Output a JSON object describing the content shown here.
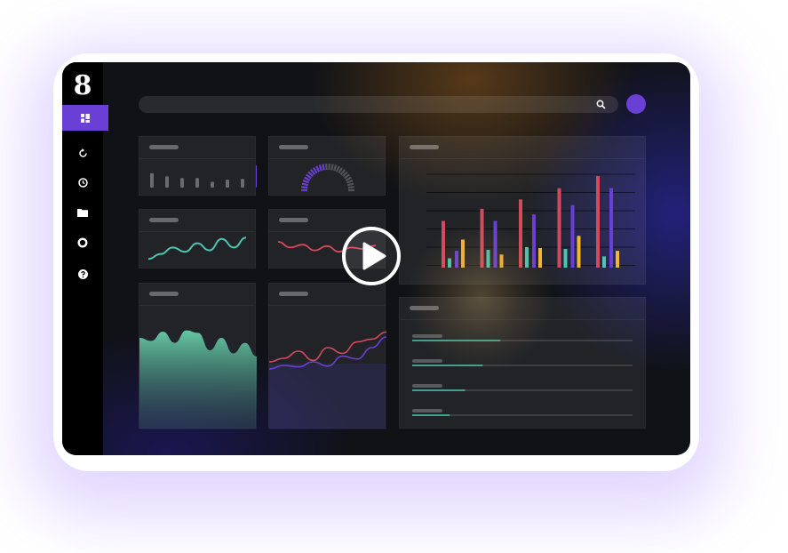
{
  "app": {
    "logo_text": "8",
    "accent_color": "#6a3fd6"
  },
  "sidebar": {
    "items": [
      {
        "icon": "dashboard-icon",
        "active": true
      },
      {
        "icon": "refresh-icon",
        "active": false
      },
      {
        "icon": "clock-icon",
        "active": false
      },
      {
        "icon": "folder-icon",
        "active": false
      },
      {
        "icon": "circle-icon",
        "active": false
      },
      {
        "icon": "help-icon",
        "active": false
      }
    ]
  },
  "header": {
    "search_icon": "search-icon",
    "avatar_color": "#6a3fd6"
  },
  "overlay": {
    "play_icon": "play-icon"
  },
  "colors": {
    "teal": "#4fc4b0",
    "red": "#d44a5c",
    "purple": "#6a3fd6",
    "yellow": "#f2b534"
  },
  "chart_data": [
    {
      "type": "bar",
      "values": [
        0.45,
        0.35,
        0.3,
        0.3,
        0.18,
        0.25,
        0.27,
        0.7
      ],
      "ylim": [
        0,
        1
      ],
      "grid": false
    },
    {
      "type": "gauge",
      "values": [
        0.45
      ],
      "ylim": [
        0,
        1
      ]
    },
    {
      "type": "line",
      "values": [
        0.15,
        0.32,
        0.55,
        0.4,
        0.7,
        0.45,
        0.85,
        0.55,
        0.9
      ],
      "ylim": [
        0,
        1
      ],
      "grid": false
    },
    {
      "type": "line",
      "values": [
        0.75,
        0.55,
        0.65,
        0.45,
        0.6,
        0.4,
        0.55,
        0.5,
        0.62
      ],
      "ylim": [
        0,
        1
      ],
      "grid": false
    },
    {
      "type": "bar",
      "series": [
        {
          "color": "#d44a5c",
          "values": [
            0.5,
            0.63,
            0.73,
            0.85,
            0.98
          ]
        },
        {
          "color": "#6a3fd6",
          "values": [
            0.18,
            0.5,
            0.57,
            0.67,
            0.85
          ]
        },
        {
          "color": "#4fc4b0",
          "values": [
            0.1,
            0.19,
            0.22,
            0.2,
            0.12
          ]
        },
        {
          "color": "#f2b534",
          "values": [
            0.3,
            0.14,
            0.21,
            0.34,
            0.18
          ]
        }
      ],
      "ylim": [
        0,
        1
      ],
      "grid": true
    },
    {
      "type": "area",
      "values": [
        0.7,
        0.65,
        0.8,
        0.62,
        0.82,
        0.78,
        0.5,
        0.7,
        0.45,
        0.62,
        0.4
      ],
      "ylim": [
        0,
        1
      ],
      "grid": false
    },
    {
      "type": "line",
      "series": [
        {
          "color": "#d44a5c",
          "values": [
            0.4,
            0.45,
            0.55,
            0.42,
            0.6,
            0.52,
            0.68,
            0.72,
            0.82
          ]
        },
        {
          "color": "#6a3fd6",
          "values": [
            0.3,
            0.35,
            0.33,
            0.4,
            0.34,
            0.48,
            0.44,
            0.6,
            0.75
          ]
        }
      ],
      "ylim": [
        0,
        1
      ],
      "grid": false
    },
    {
      "type": "bar",
      "orientation": "horizontal",
      "values": [
        0.4,
        0.32,
        0.24,
        0.17
      ],
      "ylim": [
        0,
        1
      ]
    }
  ]
}
